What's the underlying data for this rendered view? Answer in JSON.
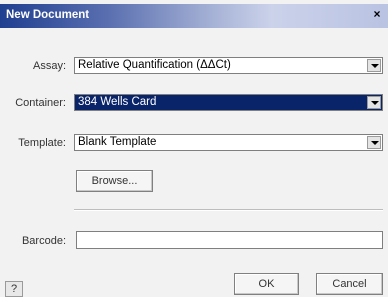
{
  "window": {
    "title": "New Document",
    "close_glyph": "×"
  },
  "form": {
    "assay": {
      "label": "Assay:",
      "value": "Relative Quantification (ΔΔCt)"
    },
    "container": {
      "label": "Container:",
      "value": "384 Wells Card"
    },
    "template": {
      "label": "Template:",
      "value": "Blank Template"
    },
    "browse_label": "Browse...",
    "barcode": {
      "label": "Barcode:",
      "value": ""
    }
  },
  "footer": {
    "help_label": "?",
    "ok_label": "OK",
    "cancel_label": "Cancel"
  },
  "colors": {
    "selection": "#0a246a",
    "title_gradient_start": "#1f3f90"
  }
}
